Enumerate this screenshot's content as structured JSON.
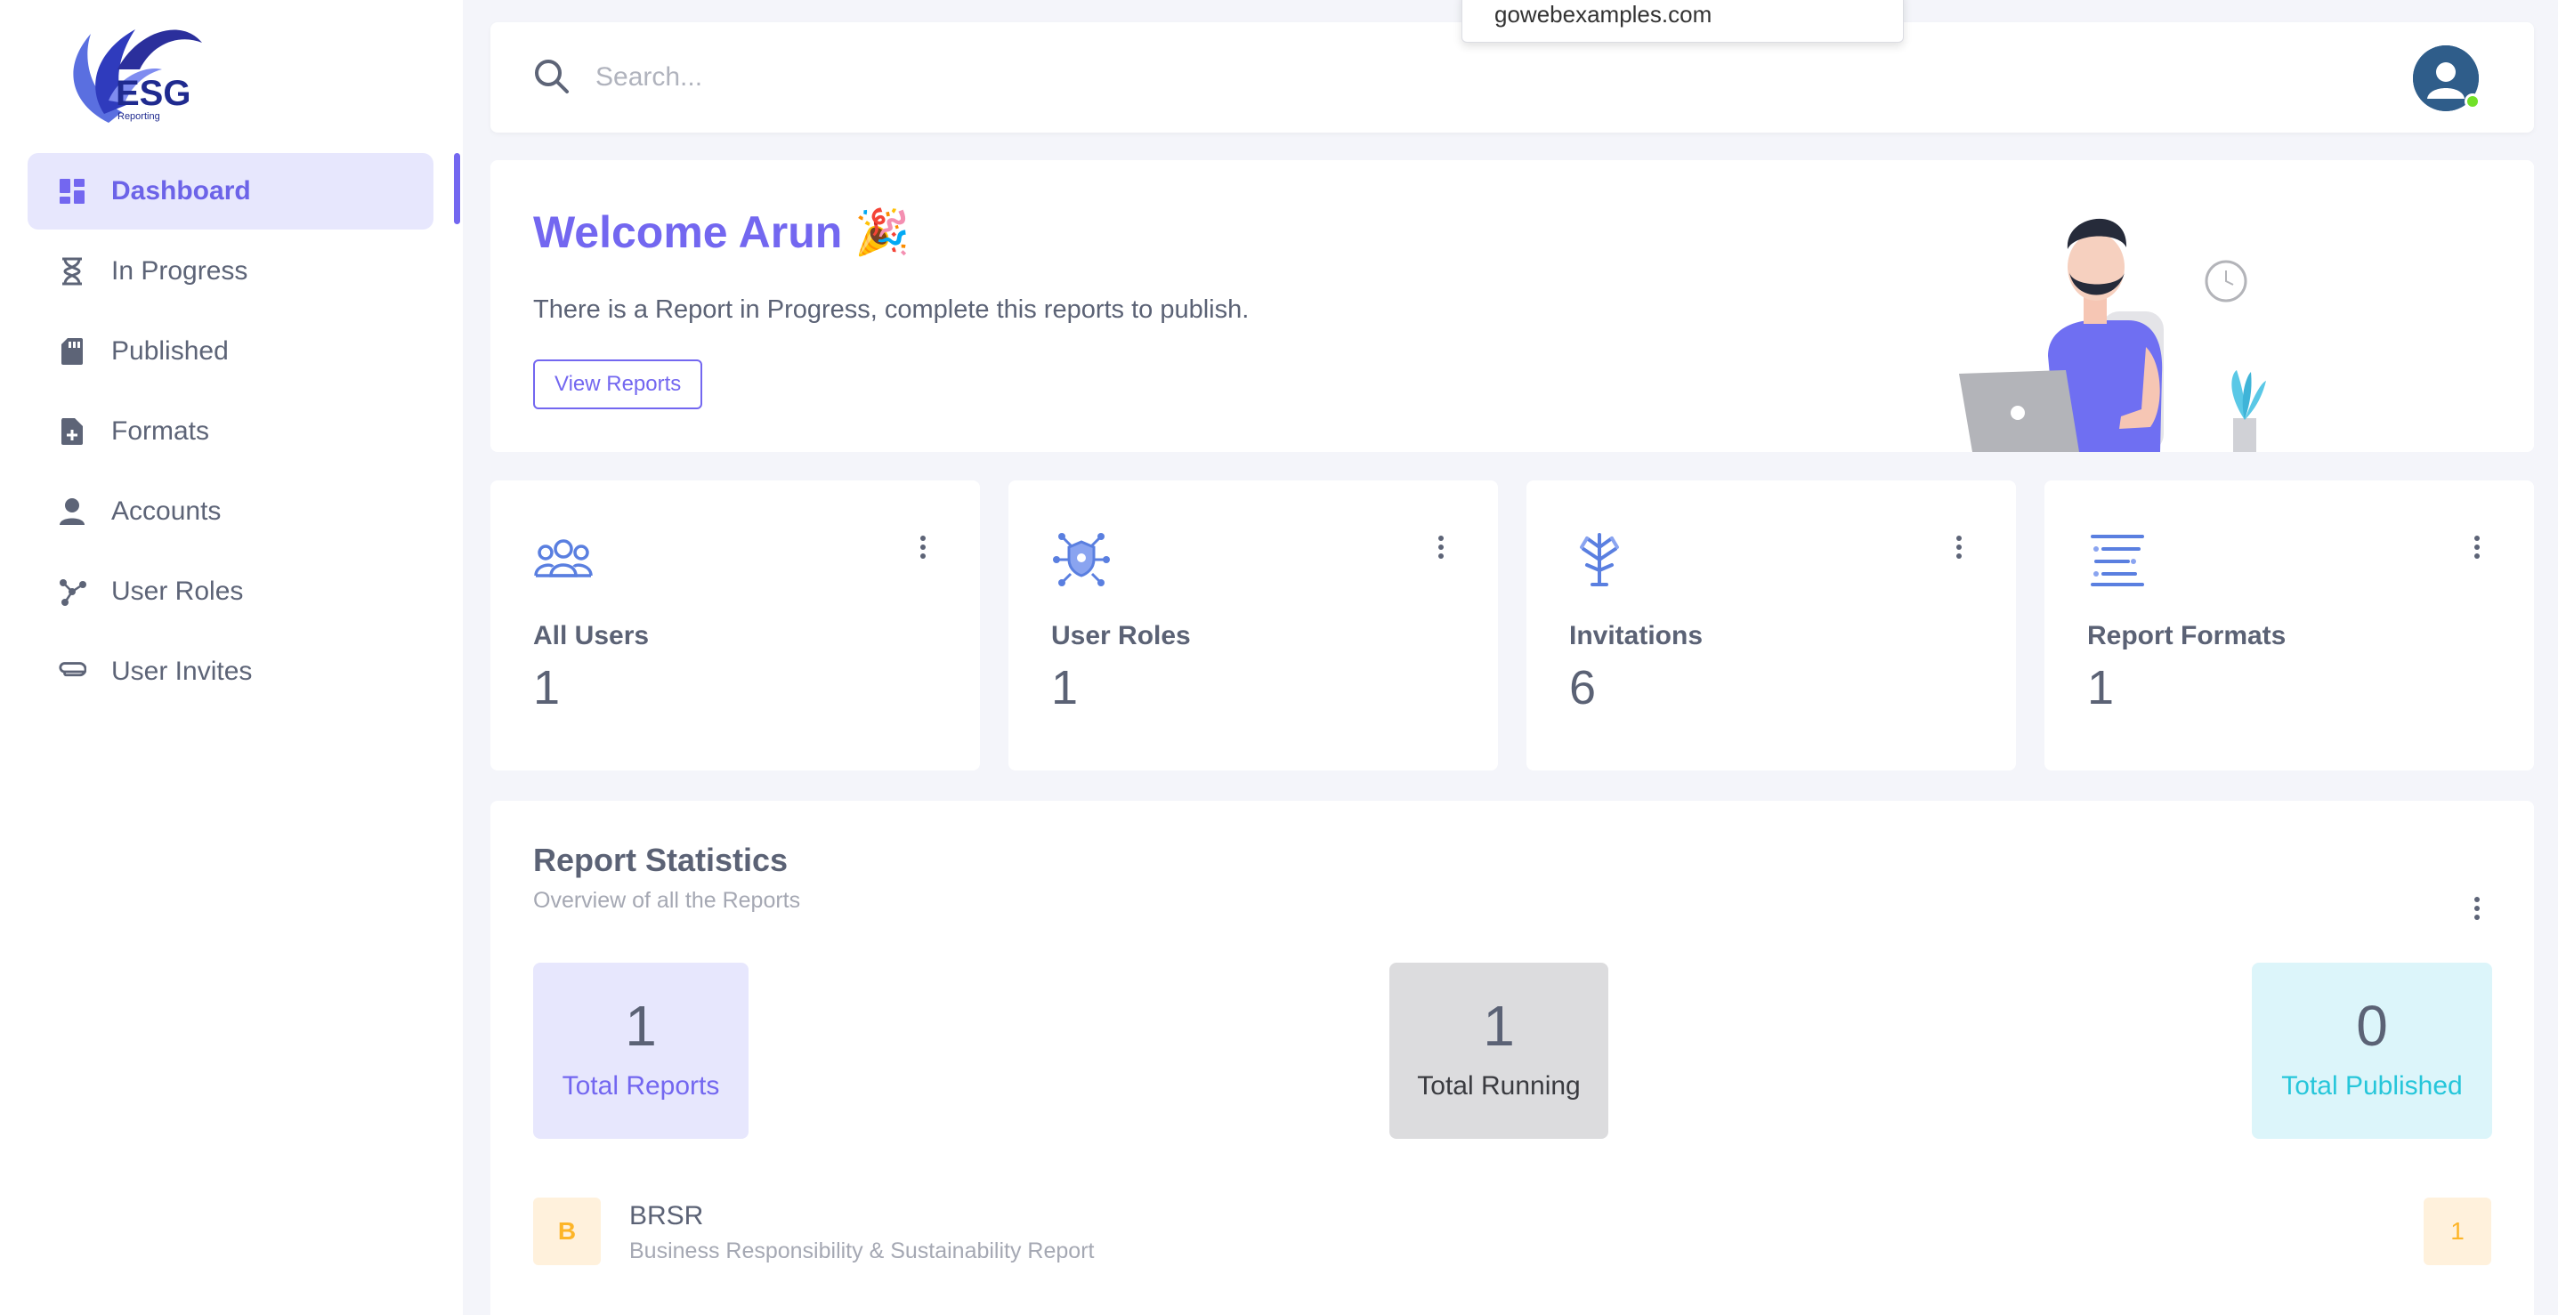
{
  "browser": {
    "url_popup": "gowebexamples.com"
  },
  "brand": {
    "logo_text": "ESG",
    "logo_subtext": "Reporting"
  },
  "sidebar": {
    "items": [
      {
        "label": "Dashboard",
        "icon": "dashboard-icon",
        "active": true
      },
      {
        "label": "In Progress",
        "icon": "hourglass-icon"
      },
      {
        "label": "Published",
        "icon": "sd-card-icon"
      },
      {
        "label": "Formats",
        "icon": "file-plus-icon"
      },
      {
        "label": "Accounts",
        "icon": "user-icon"
      },
      {
        "label": "User Roles",
        "icon": "graph-icon"
      },
      {
        "label": "User Invites",
        "icon": "paperclip-icon"
      }
    ]
  },
  "search": {
    "placeholder": "Search..."
  },
  "welcome": {
    "title": "Welcome Arun 🎉",
    "subtitle": "There is a Report in Progress, complete this reports to publish.",
    "button_label": "View Reports"
  },
  "stats": [
    {
      "label": "All Users",
      "value": "1",
      "icon": "users-icon"
    },
    {
      "label": "User Roles",
      "value": "1",
      "icon": "shield-network-icon"
    },
    {
      "label": "Invitations",
      "value": "6",
      "icon": "tree-icon"
    },
    {
      "label": "Report Formats",
      "value": "1",
      "icon": "list-icon"
    }
  ],
  "report_statistics": {
    "title": "Report Statistics",
    "subtitle": "Overview of all the Reports",
    "total_reports": {
      "value": "1",
      "label": "Total Reports"
    },
    "total_running": {
      "value": "1",
      "label": "Total Running"
    },
    "total_published": {
      "value": "0",
      "label": "Total Published"
    },
    "reports": [
      {
        "badge": "B",
        "name": "BRSR",
        "description": "Business Responsibility & Sustainability Report",
        "count": "1"
      }
    ]
  },
  "colors": {
    "primary": "#7367f0",
    "active_bg": "#e7e7fd",
    "info": "#26c6da",
    "warning": "#fdb528",
    "online": "#72e128"
  }
}
